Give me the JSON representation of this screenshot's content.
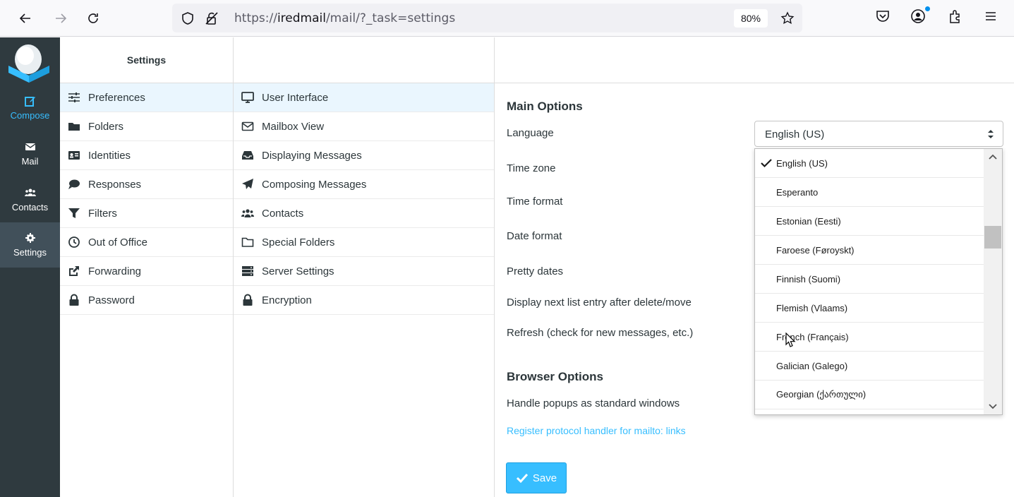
{
  "browser": {
    "url_prefix": "https://",
    "url_host": "iredmail",
    "url_path": "/mail/?_task=settings",
    "zoom": "80%"
  },
  "rail": {
    "compose": "Compose",
    "mail": "Mail",
    "contacts": "Contacts",
    "settings": "Settings"
  },
  "settings_column": {
    "title": "Settings",
    "items": [
      {
        "label": "Preferences",
        "icon": "sliders-icon"
      },
      {
        "label": "Folders",
        "icon": "folder-icon"
      },
      {
        "label": "Identities",
        "icon": "id-card-icon"
      },
      {
        "label": "Responses",
        "icon": "comment-icon"
      },
      {
        "label": "Filters",
        "icon": "filter-icon"
      },
      {
        "label": "Out of Office",
        "icon": "clock-icon"
      },
      {
        "label": "Forwarding",
        "icon": "share-icon"
      },
      {
        "label": "Password",
        "icon": "lock-icon"
      }
    ]
  },
  "sections_column": {
    "items": [
      {
        "label": "User Interface",
        "icon": "monitor-icon"
      },
      {
        "label": "Mailbox View",
        "icon": "envelope-icon"
      },
      {
        "label": "Displaying Messages",
        "icon": "inbox-icon"
      },
      {
        "label": "Composing Messages",
        "icon": "paper-plane-icon"
      },
      {
        "label": "Contacts",
        "icon": "users-icon"
      },
      {
        "label": "Special Folders",
        "icon": "folder-outline-icon"
      },
      {
        "label": "Server Settings",
        "icon": "server-icon"
      },
      {
        "label": "Encryption",
        "icon": "lock-icon"
      }
    ]
  },
  "main": {
    "main_options_title": "Main Options",
    "language_label": "Language",
    "language_value": "English (US)",
    "timezone_label": "Time zone",
    "timeformat_label": "Time format",
    "dateformat_label": "Date format",
    "prettydates_label": "Pretty dates",
    "nextentry_label": "Display next list entry after delete/move",
    "refresh_label": "Refresh (check for new messages, etc.)",
    "browser_options_title": "Browser Options",
    "popups_label": "Handle popups as standard windows",
    "protocol_link": "Register protocol handler for mailto: links",
    "save_label": "Save"
  },
  "language_dropdown": {
    "options": [
      "English (US)",
      "Esperanto",
      "Estonian (Eesti)",
      "Faroese (Føroyskt)",
      "Finnish (Suomi)",
      "Flemish (Vlaams)",
      "French (Français)",
      "Galician (Galego)",
      "Georgian (ქართული)"
    ],
    "selected": "English (US)"
  },
  "colors": {
    "rail_bg": "#2f3a3f",
    "accent": "#37beff",
    "selected_row": "#eaf6fe"
  }
}
